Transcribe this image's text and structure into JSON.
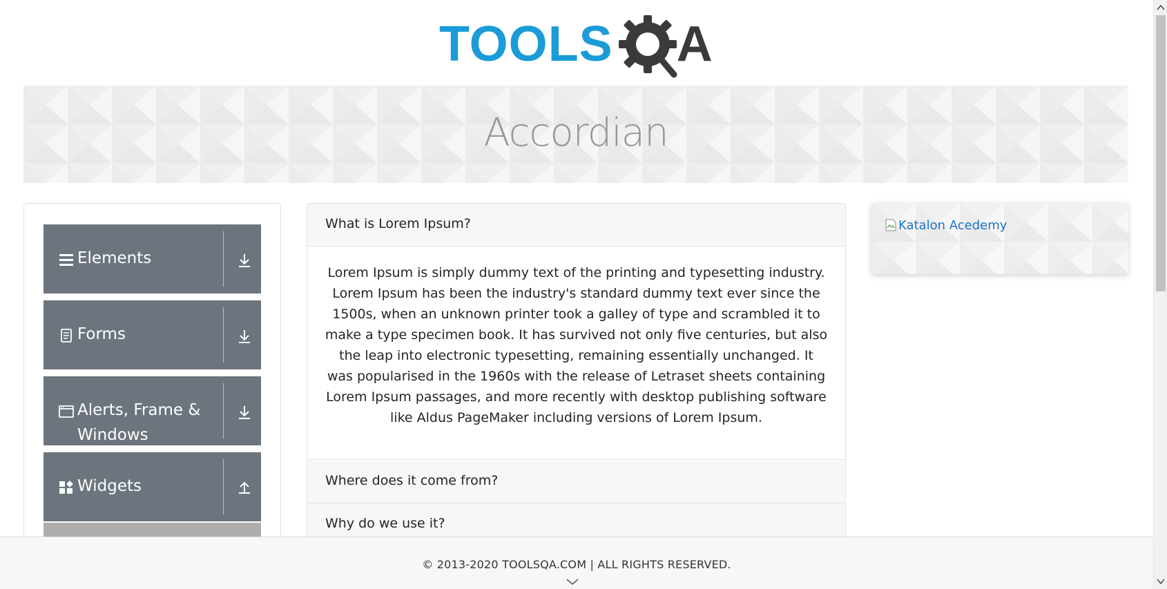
{
  "header": {
    "logo_alt": "TOOLSQA",
    "logo_tools": "TOOLS",
    "logo_a": "A"
  },
  "banner": {
    "title": "Accordian"
  },
  "sidebar": {
    "groups": [
      {
        "label": "Elements",
        "icon": "list-icon",
        "state": "collapsed"
      },
      {
        "label": "Forms",
        "icon": "document-icon",
        "state": "collapsed"
      },
      {
        "label": "Alerts, Frame & Windows",
        "icon": "window-icon",
        "state": "collapsed"
      },
      {
        "label": "Widgets",
        "icon": "widgets-icon",
        "state": "expanded"
      }
    ]
  },
  "accordion": {
    "sections": [
      {
        "heading": "What is Lorem Ipsum?",
        "expanded": true,
        "body": "Lorem Ipsum is simply dummy text of the printing and typesetting industry. Lorem Ipsum has been the industry's standard dummy text ever since the 1500s, when an unknown printer took a galley of type and scrambled it to make a type specimen book. It has survived not only five centuries, but also the leap into electronic typesetting, remaining essentially unchanged. It was popularised in the 1960s with the release of Letraset sheets containing Lorem Ipsum passages, and more recently with desktop publishing software like Aldus PageMaker including versions of Lorem Ipsum."
      },
      {
        "heading": "Where does it come from?",
        "expanded": false
      },
      {
        "heading": "Why do we use it?",
        "expanded": false
      }
    ]
  },
  "ad": {
    "alt_text": "Katalon Acedemy"
  },
  "footer": {
    "copyright": "© 2013-2020 TOOLSQA.COM | ALL RIGHTS RESERVED."
  },
  "colors": {
    "sidebar_bg": "#6c757d",
    "logo_blue": "#1b9bd7",
    "link": "#1a73c8"
  }
}
